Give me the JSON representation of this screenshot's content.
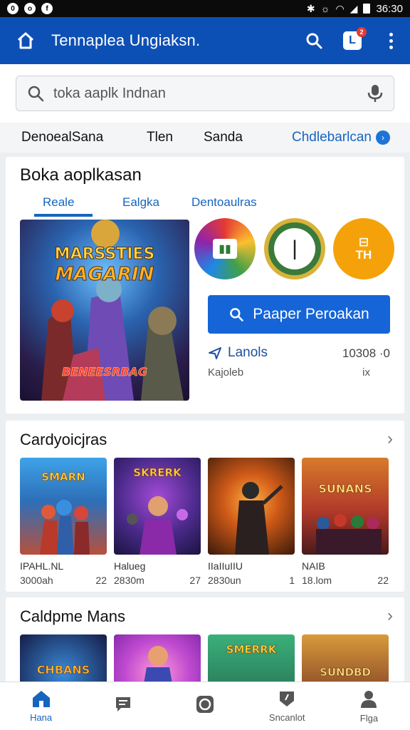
{
  "status_bar": {
    "time": "36:30"
  },
  "app_bar": {
    "title": "Tennaplea Ungiaksn.",
    "notification_count": "2",
    "notification_letter": "L"
  },
  "search": {
    "placeholder": "toka aaplk Indnan"
  },
  "categories": {
    "items": [
      "DenoealSana",
      "Tlen",
      "Sanda"
    ],
    "accent": "Chdlebarlcan"
  },
  "featured": {
    "title": "Boka aoplkasan",
    "tabs": [
      "Reale",
      "Ealgka",
      "Dentoaulras"
    ],
    "art_title_1": "MARSSTIES",
    "art_title_2": "MAGARIN",
    "art_banner": "BENEESRBAG",
    "circle3_top": "⊟",
    "circle3_bottom": "TH",
    "cta": "Paaper Peroakan",
    "meta_label": "Lanols",
    "meta_sub": "Kajoleb",
    "meta_count": "10308 ·0",
    "meta_unit": "ix"
  },
  "section1": {
    "title": "Cardyoicjras",
    "tiles": [
      {
        "art": "SMARN",
        "name": "IPAHL.NL",
        "size": "3000ah",
        "rating": "22"
      },
      {
        "art": "SKRERK",
        "name": "Halueg",
        "size": "2830m",
        "rating": "27"
      },
      {
        "art": "",
        "name": "IIaIIuIIU",
        "size": "2830un",
        "rating": "1"
      },
      {
        "art": "SUNANS",
        "name": "NAIB",
        "size": "18.lom",
        "rating": "22"
      }
    ]
  },
  "section2": {
    "title": "Caldpme Mans",
    "tiles": [
      {
        "art": "CHBANS"
      },
      {
        "art": ""
      },
      {
        "art": "SMERRK"
      },
      {
        "art": "SUNDBD"
      }
    ]
  },
  "bottom_nav": {
    "items": [
      "Hana",
      "",
      "",
      "Sncanlot",
      "Flga"
    ]
  },
  "colors": {
    "primary": "#0d50b5",
    "accent": "#1565d8",
    "orange": "#f5a20a"
  }
}
